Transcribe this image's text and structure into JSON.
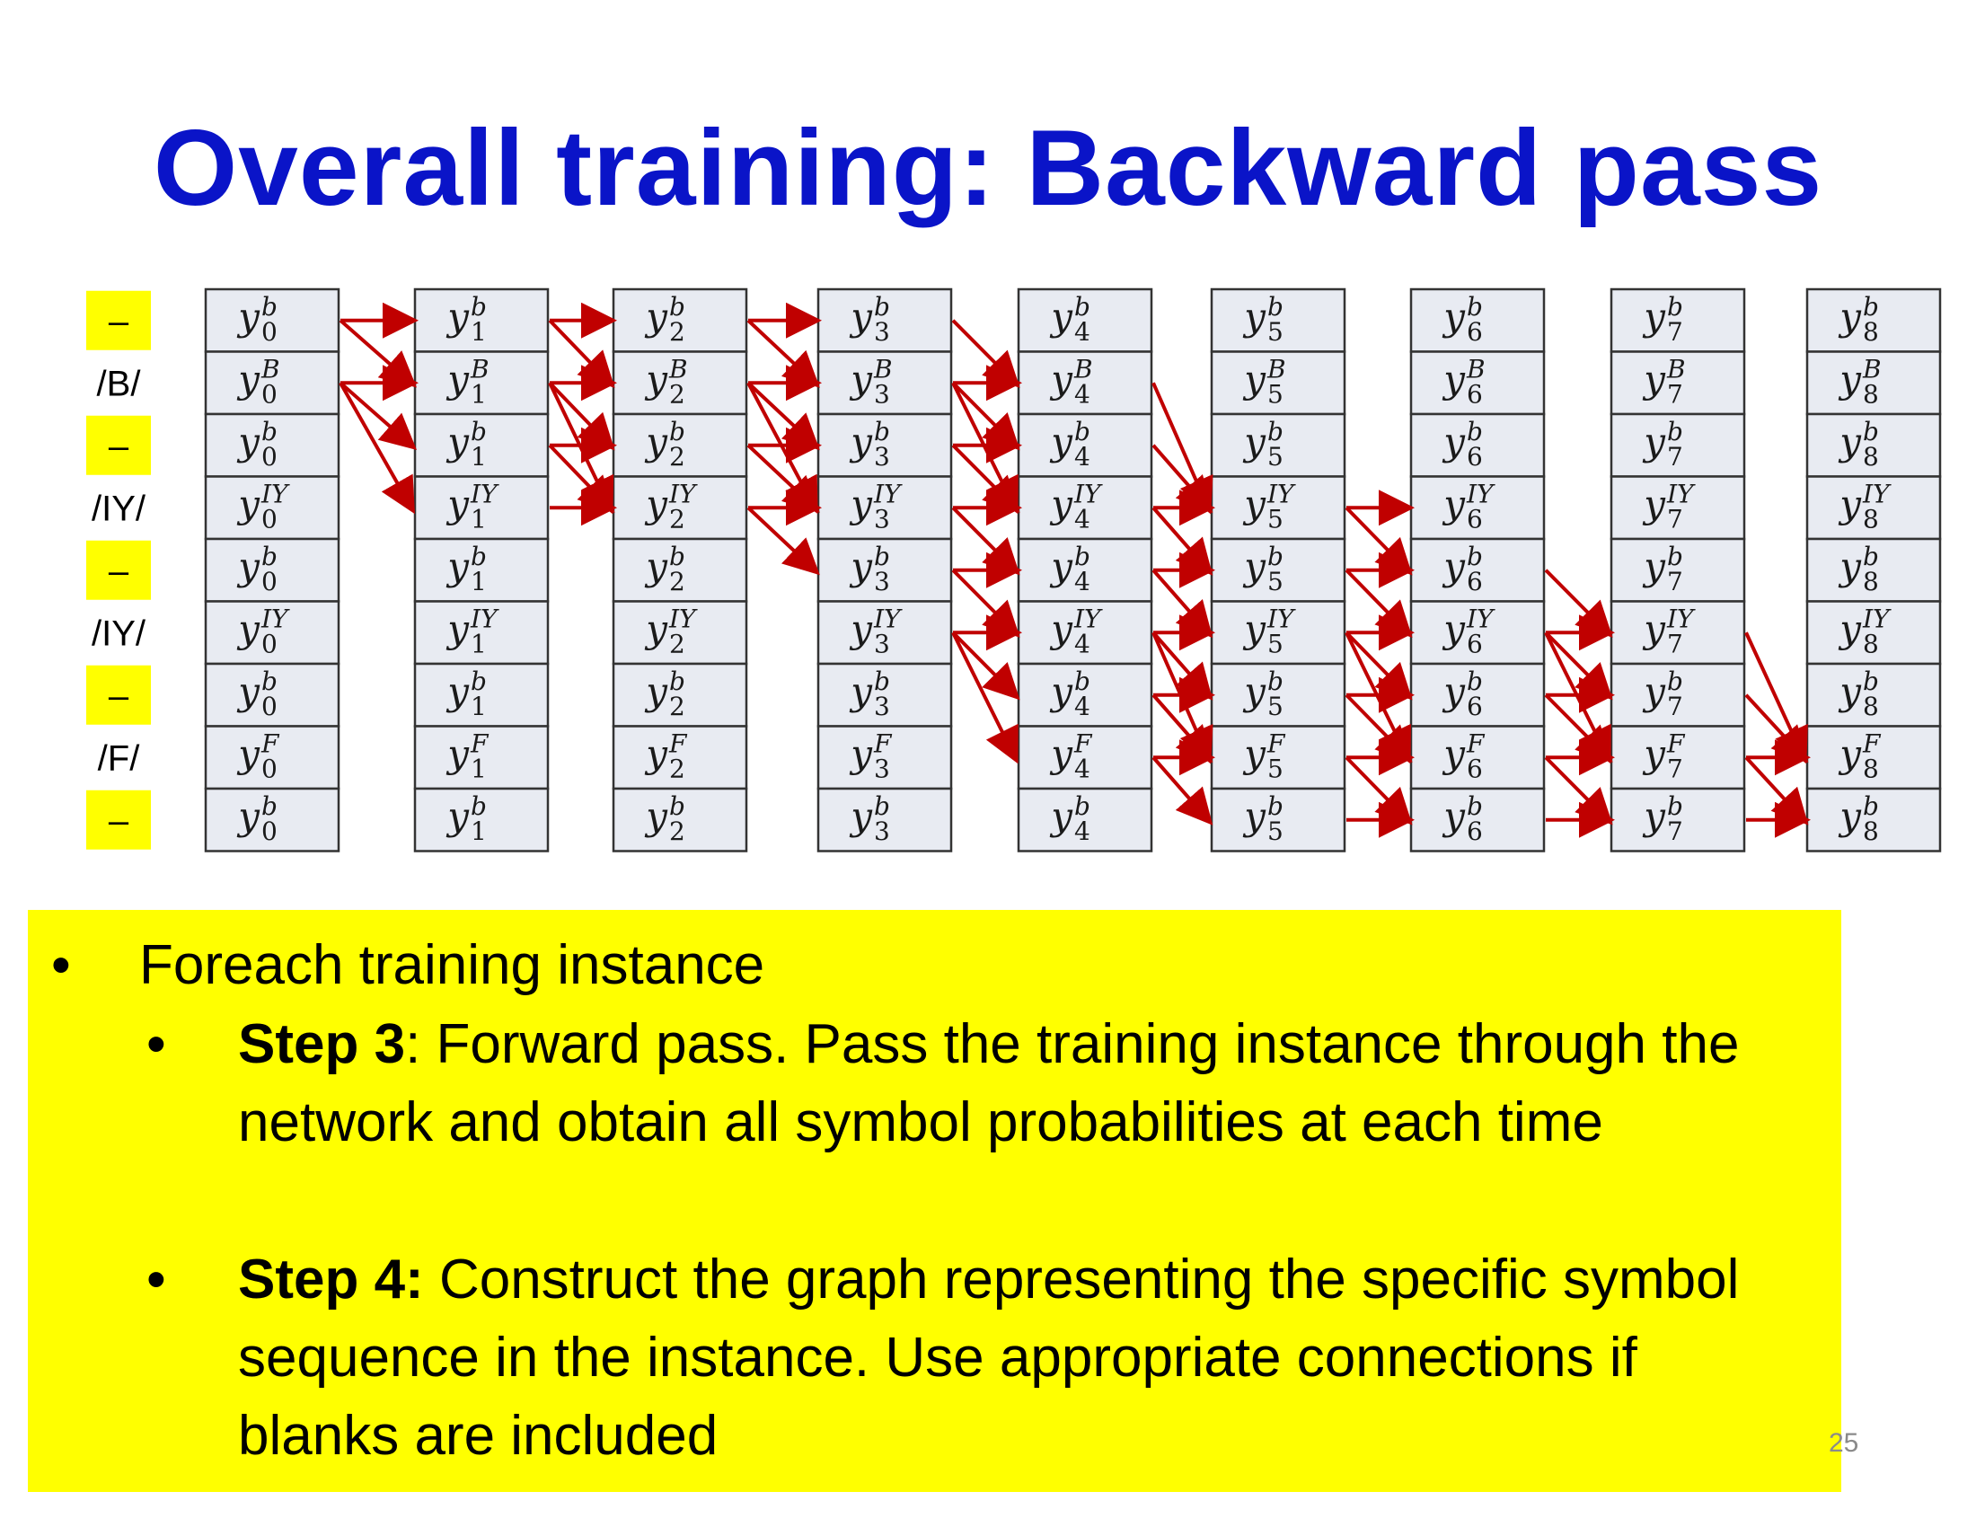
{
  "slide": {
    "title": "Overall training: Backward pass",
    "page_number": "25"
  },
  "diagram": {
    "row_labels": [
      {
        "text": "–",
        "highlight": true
      },
      {
        "text": "/B/",
        "highlight": false
      },
      {
        "text": "–",
        "highlight": true
      },
      {
        "text": "/IY/",
        "highlight": false
      },
      {
        "text": "–",
        "highlight": true
      },
      {
        "text": "/IY/",
        "highlight": false
      },
      {
        "text": "–",
        "highlight": true
      },
      {
        "text": "/F/",
        "highlight": false
      },
      {
        "text": "–",
        "highlight": true
      }
    ],
    "row_symbols": [
      "b",
      "B",
      "b",
      "IY",
      "b",
      "IY",
      "b",
      "F",
      "b"
    ],
    "time_steps": [
      "0",
      "1",
      "2",
      "3",
      "4",
      "5",
      "6",
      "7",
      "8"
    ],
    "cell_letter": "y",
    "arrow_color": "#c00000",
    "highlight_color": "#ffff00",
    "cell_fill": "#e8ebf2"
  },
  "notes": {
    "bullets": [
      {
        "text": "Foreach training instance",
        "children": [
          {
            "bold": "Step 3",
            "text": ":  Forward pass. Pass the training instance through the network and obtain all symbol probabilities at each time"
          },
          {
            "bold": "Step 4:",
            "text": " Construct the graph representing the specific symbol sequence in the instance. Use appropriate connections if blanks are included"
          }
        ]
      }
    ]
  }
}
